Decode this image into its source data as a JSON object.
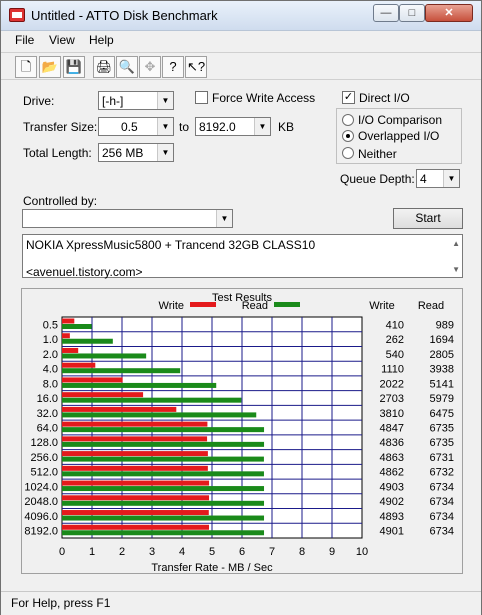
{
  "window": {
    "title": "Untitled - ATTO Disk Benchmark",
    "min": "—",
    "max": "□",
    "close": "✕"
  },
  "menu": [
    "File",
    "View",
    "Help"
  ],
  "toolbar": [
    {
      "name": "new-icon",
      "glyph": "🗋"
    },
    {
      "name": "open-icon",
      "glyph": "📂"
    },
    {
      "name": "save-icon",
      "glyph": "💾"
    },
    {
      "name": "print-icon",
      "glyph": "🖨"
    },
    {
      "name": "print-preview-icon",
      "glyph": "🔍"
    },
    {
      "name": "move-icon",
      "glyph": "✥",
      "disabled": true
    },
    {
      "name": "help-icon",
      "glyph": "?"
    },
    {
      "name": "context-help-icon",
      "glyph": "↖?"
    }
  ],
  "settings": {
    "drive_label": "Drive:",
    "drive_value": "[-h-]",
    "force_write_label": "Force Write Access",
    "force_write_checked": false,
    "direct_io_label": "Direct I/O",
    "direct_io_checked": true,
    "transfer_size_label": "Transfer Size:",
    "transfer_from": "0.5",
    "transfer_to_label": "to",
    "transfer_to": "8192.0",
    "transfer_unit": "KB",
    "total_length_label": "Total Length:",
    "total_length_value": "256 MB",
    "io_modes": [
      {
        "label": "I/O Comparison",
        "selected": false
      },
      {
        "label": "Overlapped I/O",
        "selected": true
      },
      {
        "label": "Neither",
        "selected": false
      }
    ],
    "queue_depth_label": "Queue Depth:",
    "queue_depth_value": "4",
    "controlled_by_label": "Controlled by:",
    "controlled_by_value": "",
    "start_label": "Start",
    "description_line1": "NOKIA XpressMusic5800 + Trancend 32GB CLASS10",
    "description_line2": "<avenuel.tistory.com>"
  },
  "results": {
    "title": "Test Results",
    "write_legend": "Write",
    "read_legend": "Read",
    "write_col": "Write",
    "read_col": "Read"
  },
  "chart_data": {
    "type": "bar",
    "orientation": "horizontal",
    "categories": [
      "0.5",
      "1.0",
      "2.0",
      "4.0",
      "8.0",
      "16.0",
      "32.0",
      "64.0",
      "128.0",
      "256.0",
      "512.0",
      "1024.0",
      "2048.0",
      "4096.0",
      "8192.0"
    ],
    "series": [
      {
        "name": "Write",
        "color": "#e41a1c",
        "values": [
          410,
          262,
          540,
          1110,
          2022,
          2703,
          3810,
          4847,
          4836,
          4863,
          4862,
          4903,
          4902,
          4893,
          4901
        ]
      },
      {
        "name": "Read",
        "color": "#1a8a1a",
        "values": [
          989,
          1694,
          2805,
          3938,
          5141,
          5979,
          6475,
          6735,
          6735,
          6731,
          6732,
          6734,
          6734,
          6734,
          6734
        ]
      }
    ],
    "xlabel": "Transfer Rate - MB / Sec",
    "xlim": [
      0,
      10
    ],
    "xticks": [
      "0",
      "1",
      "2",
      "3",
      "4",
      "5",
      "6",
      "7",
      "8",
      "9",
      "10"
    ],
    "grid": true
  },
  "status": {
    "text": "For Help, press F1"
  }
}
